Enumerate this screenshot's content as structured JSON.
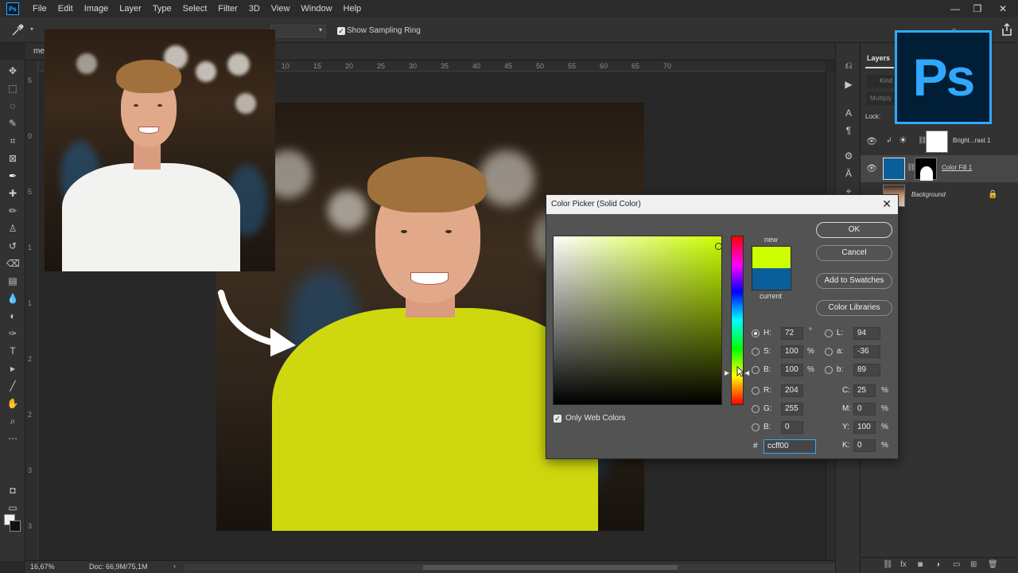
{
  "menu": {
    "app_icon": "Ps",
    "items": [
      "File",
      "Edit",
      "Image",
      "Layer",
      "Type",
      "Select",
      "Filter",
      "3D",
      "View",
      "Window",
      "Help"
    ]
  },
  "window_controls": {
    "minimize": "—",
    "restore": "❐",
    "close": "✕"
  },
  "options_bar": {
    "show_sampling_ring_label": "Show Sampling Ring",
    "show_sampling_ring_checked": true
  },
  "document": {
    "tab_label": "me",
    "ruler_top_ticks": [
      "10",
      "15",
      "20",
      "25",
      "30",
      "35",
      "40",
      "45",
      "50",
      "55",
      "60",
      "65",
      "70"
    ],
    "ruler_left_ticks": [
      "5",
      "0",
      "5",
      "1",
      "1",
      "2",
      "2",
      "3",
      "3"
    ]
  },
  "status": {
    "zoom": "16,67%",
    "doc": "Doc: 66,9M/75,1M"
  },
  "layers_panel": {
    "tab": "Layers",
    "kind_placeholder": "Kind",
    "blend_mode": "Multiply",
    "lock_label": "Lock:",
    "layers": [
      {
        "name": "Bright...rast 1",
        "selected": false
      },
      {
        "name": "Color Fill 1",
        "selected": true
      },
      {
        "name": "Background",
        "selected": false
      }
    ]
  },
  "logo": {
    "text": "Ps"
  },
  "color_picker": {
    "title": "Color Picker (Solid Color)",
    "new_label": "new",
    "current_label": "current",
    "new_color": "#ccff00",
    "current_color": "#0a5f9a",
    "buttons": {
      "ok": "OK",
      "cancel": "Cancel",
      "add_to_swatches": "Add to Swatches",
      "color_libraries": "Color Libraries"
    },
    "hsb": {
      "h_label": "H:",
      "h": "72",
      "h_unit": "°",
      "s_label": "S:",
      "s": "100",
      "s_unit": "%",
      "b_label": "B:",
      "b": "100",
      "b_unit": "%"
    },
    "rgb": {
      "r_label": "R:",
      "r": "204",
      "g_label": "G:",
      "g": "255",
      "b_label": "B:",
      "b": "0"
    },
    "lab": {
      "l_label": "L:",
      "l": "94",
      "a_label": "a:",
      "a": "-36",
      "b_label": "b:",
      "b": "89"
    },
    "cmyk": {
      "c_label": "C:",
      "c": "25",
      "m_label": "M:",
      "m": "0",
      "y_label": "Y:",
      "y": "100",
      "k_label": "K:",
      "k": "0",
      "unit": "%"
    },
    "hex_label": "#",
    "hex": "ccff00",
    "only_web_colors_label": "Only Web Colors",
    "only_web_colors_checked": true
  }
}
